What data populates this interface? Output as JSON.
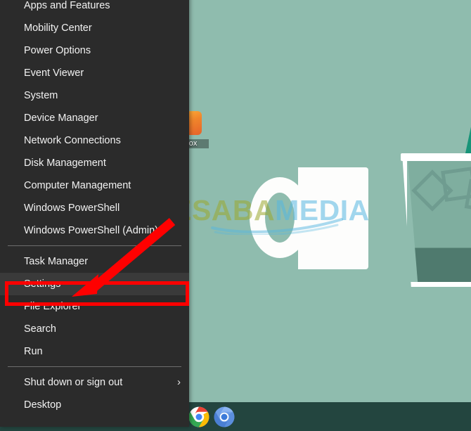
{
  "desktop": {
    "background_color": "#8fbcae",
    "watermark": {
      "text_primary": "NESABA",
      "text_secondary": "MEDIA",
      "color_primary": "#9ba72d",
      "color_secondary": "#56b6e0"
    },
    "icons": [
      {
        "name": "firefox-desktop-icon",
        "label": "efox"
      }
    ],
    "illustrations": [
      {
        "name": "coffee-mug",
        "color": "#fdfdfc"
      },
      {
        "name": "iced-drink-glass",
        "color": "#ffffff",
        "straw_color": "#179478"
      }
    ]
  },
  "taskbar": {
    "background_color": "#23453f",
    "items": [
      {
        "name": "chrome-taskbar-icon",
        "label": "Google Chrome"
      },
      {
        "name": "chromium-taskbar-icon",
        "label": "Chromium"
      }
    ]
  },
  "winx_menu": {
    "background_color": "#2b2b2b",
    "highlight_color": "#3a3a3a",
    "groups": [
      {
        "items": [
          {
            "label": "Apps and Features",
            "highlighted": false,
            "submenu": false
          },
          {
            "label": "Mobility Center",
            "highlighted": false,
            "submenu": false
          },
          {
            "label": "Power Options",
            "highlighted": false,
            "submenu": false
          },
          {
            "label": "Event Viewer",
            "highlighted": false,
            "submenu": false
          },
          {
            "label": "System",
            "highlighted": false,
            "submenu": false
          },
          {
            "label": "Device Manager",
            "highlighted": false,
            "submenu": false
          },
          {
            "label": "Network Connections",
            "highlighted": false,
            "submenu": false
          },
          {
            "label": "Disk Management",
            "highlighted": false,
            "submenu": false
          },
          {
            "label": "Computer Management",
            "highlighted": false,
            "submenu": false
          },
          {
            "label": "Windows PowerShell",
            "highlighted": false,
            "submenu": false
          },
          {
            "label": "Windows PowerShell (Admin)",
            "highlighted": false,
            "submenu": false
          }
        ]
      },
      {
        "items": [
          {
            "label": "Task Manager",
            "highlighted": false,
            "submenu": false
          },
          {
            "label": "Settings",
            "highlighted": true,
            "submenu": false
          },
          {
            "label": "File Explorer",
            "highlighted": false,
            "submenu": false
          },
          {
            "label": "Search",
            "highlighted": false,
            "submenu": false
          },
          {
            "label": "Run",
            "highlighted": false,
            "submenu": false
          }
        ]
      },
      {
        "items": [
          {
            "label": "Shut down or sign out",
            "highlighted": false,
            "submenu": true,
            "submenu_glyph": "›"
          },
          {
            "label": "Desktop",
            "highlighted": false,
            "submenu": false
          }
        ]
      }
    ]
  },
  "annotations": {
    "color": "#ff0000",
    "highlight_box_target": "Settings",
    "arrow_target": "Settings"
  }
}
